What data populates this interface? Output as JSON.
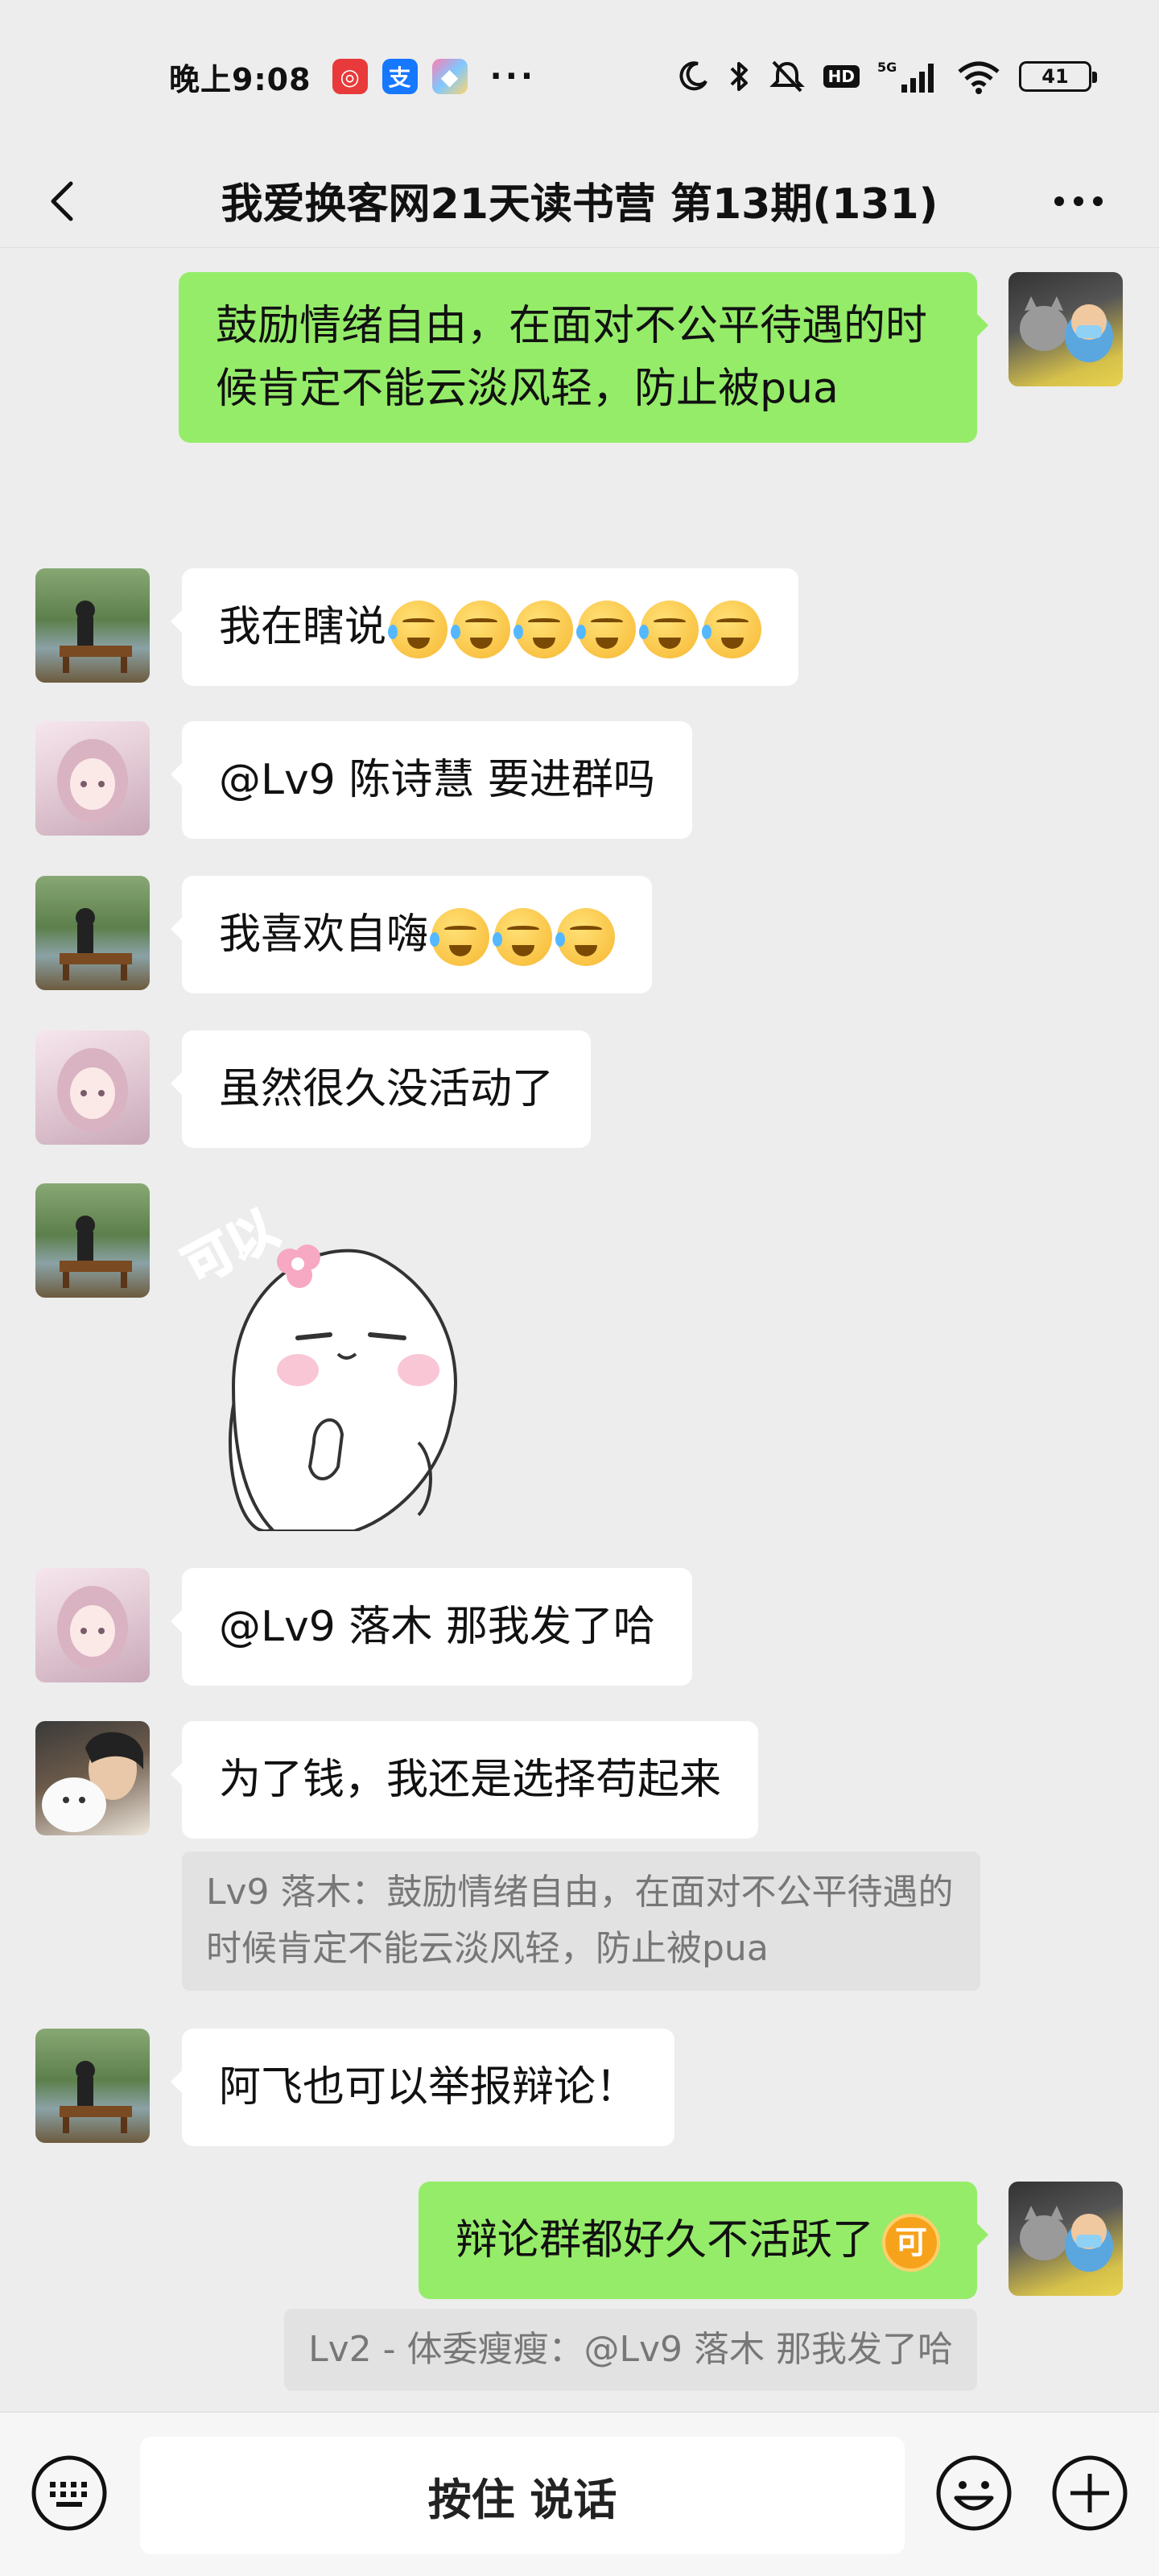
{
  "status_bar": {
    "time": "晚上9:08",
    "more": "···",
    "network": "5G",
    "hd": "HD",
    "battery": "41",
    "app_icons": [
      {
        "name": "netease-music-icon",
        "color": "#e83a3a",
        "glyph": "◎"
      },
      {
        "name": "alipay-icon",
        "color": "#1677ff",
        "glyph": "支"
      },
      {
        "name": "app-icon",
        "color": "#ff6fa8",
        "glyph": "◆"
      }
    ]
  },
  "header": {
    "title": "我爱换客网21天读书营 第13期(131)"
  },
  "messages": [
    {
      "side": "right",
      "text": "鼓励情绪自由，在面对不公平待遇的时候肯定不能云淡风轻，防止被pua"
    },
    {
      "side": "left",
      "text": "我在瞎说",
      "emojis": 6
    },
    {
      "side": "left",
      "text": "@Lv9 陈诗慧  要进群吗"
    },
    {
      "side": "left",
      "text": "我喜欢自嗨",
      "emojis": 3
    },
    {
      "side": "left",
      "text": "虽然很久没活动了"
    },
    {
      "side": "left",
      "type": "sticker",
      "sticker_text": "可以"
    },
    {
      "side": "left",
      "text": "@Lv9 落木  那我发了哈"
    },
    {
      "side": "left",
      "text": "为了钱，我还是选择苟起来",
      "quote": "Lv9 落木：鼓励情绪自由，在面对不公平待遇的时候肯定不能云淡风轻，防止被pua"
    },
    {
      "side": "left",
      "text": "阿飞也可以举报辩论！"
    },
    {
      "side": "right",
      "text": "辩论群都好久不活跃了",
      "badge": "可",
      "quote": "Lv2 - 体委瘦瘦：@Lv9 落木 那我发了哈"
    }
  ],
  "input_bar": {
    "hold_to_talk": "按住 说话"
  },
  "colors": {
    "background": "#ededed",
    "bubble_self": "#95ec69",
    "bubble_other": "#ffffff",
    "quote_bg": "#e2e2e2"
  }
}
